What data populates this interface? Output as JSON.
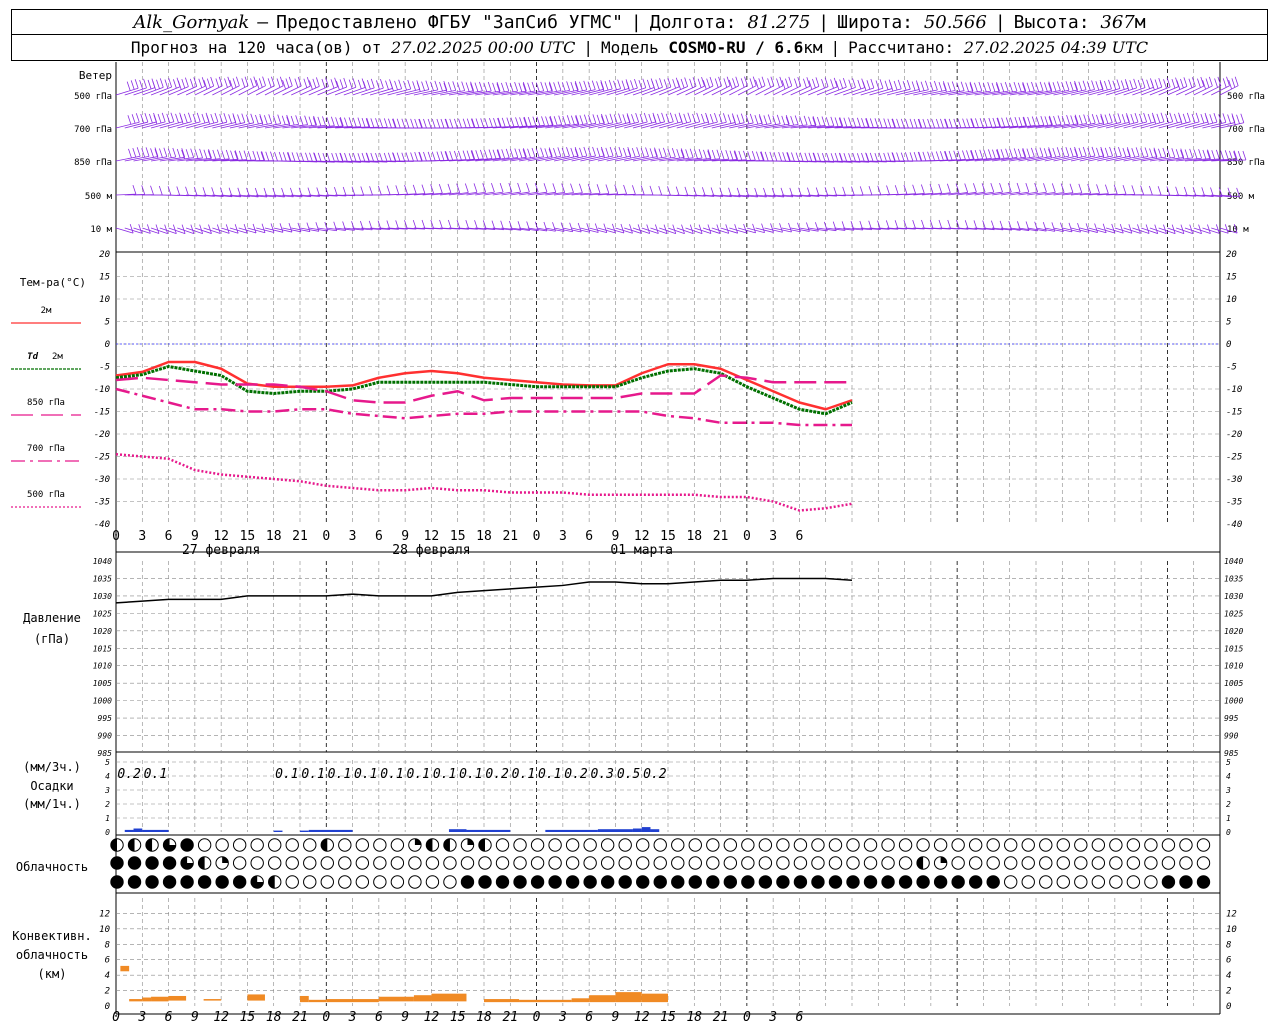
{
  "header": {
    "station": "Alk_Gornyak",
    "provider": "Предоставлено ФГБУ \"ЗапСиб УГМС\"",
    "lon_label": "Долгота:",
    "lon": "81.275",
    "lat_label": "Широта:",
    "lat": "50.566",
    "alt_label": "Высота:",
    "alt": "367",
    "alt_unit": "м",
    "forecast_label": "Прогноз на 120 часа(ов) от",
    "forecast_time": "27.02.2025 00:00 UTC",
    "model_label": "Модель",
    "model": "COSMO-RU / 6.6",
    "model_unit": "км",
    "calc_label": "Рассчитано:",
    "calc_time": "27.02.2025 04:39 UTC"
  },
  "colors": {
    "wind": "#8a2be2",
    "t2m": "#ff3030",
    "td2m": "#007000",
    "t850": "#e6198c",
    "t700": "#e6198c",
    "t500": "#e6198c",
    "pressure": "#000000",
    "precip": "#2040d0",
    "convective": "#f08a24",
    "zero_line": "#3030ff",
    "grid": "#888888"
  },
  "chart_data": [
    {
      "type": "wind_barbs",
      "title": "Ветер",
      "levels": [
        "500 гПа",
        "700 гПа",
        "850 гПа",
        "500 м",
        "10 м"
      ],
      "step_hours": 1,
      "hours": [
        0,
        126
      ]
    },
    {
      "type": "line",
      "title": "Тем-ра(°С)",
      "ylim": [
        -40,
        20
      ],
      "yticks": [
        20,
        15,
        10,
        5,
        0,
        -5,
        -10,
        -15,
        -20,
        -25,
        -30,
        -35,
        -40
      ],
      "x_hours_step": 3,
      "series": [
        {
          "name": "2м",
          "color_key": "t2m",
          "style": "solid",
          "values": [
            -7.0,
            -6.2,
            -4.0,
            -4.0,
            -5.5,
            -8.8,
            -9.5,
            -9.5,
            -9.5,
            -9.2,
            -7.5,
            -6.5,
            -6.0,
            -6.5,
            -7.5,
            -8.0,
            -8.5,
            -9.0,
            -9.2,
            -9.2,
            -6.5,
            -4.5,
            -4.5,
            -5.5,
            -8.0,
            -10.5,
            -13.0,
            -14.5,
            -12.5
          ]
        },
        {
          "name_label": "Td",
          "name": "2м",
          "color_key": "td2m",
          "style": "dotted",
          "values": [
            -7.5,
            -6.8,
            -5.0,
            -6.0,
            -7.0,
            -10.5,
            -11.0,
            -10.5,
            -10.5,
            -10.0,
            -8.5,
            -8.5,
            -8.5,
            -8.5,
            -8.5,
            -9.0,
            -9.5,
            -9.5,
            -9.5,
            -9.5,
            -7.5,
            -6.0,
            -5.5,
            -6.5,
            -9.5,
            -12.0,
            -14.5,
            -15.5,
            -13.0
          ]
        },
        {
          "name": "850 гПа",
          "color_key": "t850",
          "style": "dashed",
          "values": [
            -8.0,
            -7.5,
            -8.0,
            -8.5,
            -9.0,
            -9.0,
            -9.0,
            -9.5,
            -10.5,
            -12.5,
            -13.0,
            -13.0,
            -11.5,
            -10.5,
            -12.5,
            -12.0,
            -12.0,
            -12.0,
            -12.0,
            -12.0,
            -11.0,
            -11.0,
            -11.0,
            -7.0,
            -7.5,
            -8.5,
            -8.5,
            -8.5,
            -8.5
          ]
        },
        {
          "name": "700 гПа",
          "color_key": "t700",
          "style": "dashdot",
          "values": [
            -10.0,
            -11.5,
            -13.0,
            -14.5,
            -14.5,
            -15.0,
            -15.0,
            -14.5,
            -14.5,
            -15.5,
            -16.0,
            -16.5,
            -16.0,
            -15.5,
            -15.5,
            -15.0,
            -15.0,
            -15.0,
            -15.0,
            -15.0,
            -15.0,
            -16.0,
            -16.5,
            -17.5,
            -17.5,
            -17.5,
            -18.0,
            -18.0,
            -18.0
          ]
        },
        {
          "name": "500 гПа",
          "color_key": "t500",
          "style": "fine-dotted",
          "values": [
            -24.5,
            -25.0,
            -25.5,
            -28.0,
            -29.0,
            -29.5,
            -30.0,
            -30.5,
            -31.5,
            -32.0,
            -32.5,
            -32.5,
            -32.0,
            -32.5,
            -32.5,
            -33.0,
            -33.0,
            -33.0,
            -33.5,
            -33.5,
            -33.5,
            -33.5,
            -33.5,
            -34.0,
            -34.0,
            -35.0,
            -37.0,
            -36.5,
            -35.5
          ]
        }
      ]
    },
    {
      "type": "line",
      "title": "Давление",
      "ylabel": "(гПа)",
      "ylim": [
        985,
        1040
      ],
      "yticks": [
        1040,
        1035,
        1030,
        1025,
        1020,
        1015,
        1010,
        1005,
        1000,
        995,
        990,
        985
      ],
      "x_hours_step": 3,
      "series": [
        {
          "color_key": "pressure",
          "values": [
            1028.0,
            1028.5,
            1029.0,
            1029.0,
            1029.0,
            1030.0,
            1030.0,
            1030.0,
            1030.0,
            1030.5,
            1030.0,
            1030.0,
            1030.0,
            1031.0,
            1031.5,
            1032.0,
            1032.5,
            1033.0,
            1034.0,
            1034.0,
            1033.5,
            1033.5,
            1034.0,
            1034.5,
            1034.5,
            1035.0,
            1035.0,
            1035.0,
            1034.5
          ]
        }
      ]
    },
    {
      "type": "bar",
      "title": "Осадки",
      "units_3h": "(мм/3ч.)",
      "units_1h": "(мм/1ч.)",
      "ylim": [
        0,
        5
      ],
      "yticks": [
        5,
        4,
        3,
        2,
        1,
        0
      ],
      "amounts_3h": [
        {
          "h": 1.5,
          "label": "0.2"
        },
        {
          "h": 4.5,
          "label": "0.1"
        },
        {
          "h": 19.5,
          "label": "0.1"
        },
        {
          "h": 22.5,
          "label": "0.1"
        },
        {
          "h": 25.5,
          "label": "0.1"
        },
        {
          "h": 28.5,
          "label": "0.1"
        },
        {
          "h": 31.5,
          "label": "0.1"
        },
        {
          "h": 34.5,
          "label": "0.1"
        },
        {
          "h": 37.5,
          "label": "0.1"
        },
        {
          "h": 40.5,
          "label": "0.1"
        },
        {
          "h": 43.5,
          "label": "0.2"
        },
        {
          "h": 46.5,
          "label": "0.1"
        },
        {
          "h": 49.5,
          "label": "0.1"
        },
        {
          "h": 52.5,
          "label": "0.2"
        },
        {
          "h": 55.5,
          "label": "0.3"
        },
        {
          "h": 58.5,
          "label": "0.5"
        },
        {
          "h": 61.5,
          "label": "0.2"
        }
      ],
      "hourly": [
        {
          "from": 1,
          "to": 2,
          "v": 0.15
        },
        {
          "from": 2,
          "to": 3,
          "v": 0.25
        },
        {
          "from": 3,
          "to": 6,
          "v": 0.15
        },
        {
          "from": 18,
          "to": 19,
          "v": 0.1
        },
        {
          "from": 21,
          "to": 22,
          "v": 0.1
        },
        {
          "from": 22,
          "to": 27,
          "v": 0.15
        },
        {
          "from": 38,
          "to": 40,
          "v": 0.2
        },
        {
          "from": 40,
          "to": 45,
          "v": 0.15
        },
        {
          "from": 49,
          "to": 55,
          "v": 0.15
        },
        {
          "from": 55,
          "to": 59,
          "v": 0.2
        },
        {
          "from": 59,
          "to": 60,
          "v": 0.25
        },
        {
          "from": 60,
          "to": 61,
          "v": 0.35
        },
        {
          "from": 61,
          "to": 62,
          "v": 0.2
        }
      ]
    },
    {
      "type": "cloud_symbols",
      "title": "Облачность",
      "step_hours": 2,
      "count": 63,
      "rows": {
        "upper": {
          "partial": {
            "0": "0.5",
            "1": "0.5",
            "2": "0.5",
            "3": "0.75",
            "4": "1",
            "12": "0.5",
            "17": "0.25",
            "18": "0.5",
            "19": "0.5",
            "20": "0.25",
            "21": "0.5"
          }
        },
        "middle": {
          "partial": {
            "0": "1",
            "1": "1",
            "2": "1",
            "3": "1",
            "4": "0.75",
            "5": "0.5",
            "6": "0.25",
            "46": "0.5",
            "47": "0.25"
          }
        },
        "lower": {
          "full_from": 0,
          "full_to": 50,
          "partial": {
            "8": "0.75",
            "9": "0.5",
            "10": "0",
            "11": "0",
            "12": "0",
            "13": "0",
            "14": "0",
            "15": "0",
            "16": "0",
            "17": "0",
            "18": "0",
            "19": "0",
            "61": "1",
            "62": "1",
            "60": "1"
          }
        }
      }
    },
    {
      "type": "bar",
      "title": "Конвективн. облачность",
      "ylabel": "(км)",
      "ylim": [
        0,
        14
      ],
      "yticks": [
        12,
        10,
        8,
        6,
        4,
        2,
        0
      ],
      "segments": [
        {
          "from": 0.5,
          "to": 1.5,
          "bottom": 4.5,
          "top": 5.2
        },
        {
          "from": 1.5,
          "to": 3,
          "bottom": 0.6,
          "top": 0.9
        },
        {
          "from": 3,
          "to": 4,
          "bottom": 0.6,
          "top": 1.1
        },
        {
          "from": 4,
          "to": 6,
          "bottom": 0.6,
          "top": 1.2
        },
        {
          "from": 6,
          "to": 8,
          "bottom": 0.7,
          "top": 1.3
        },
        {
          "from": 10,
          "to": 12,
          "bottom": 0.7,
          "top": 0.9
        },
        {
          "from": 15,
          "to": 17,
          "bottom": 0.7,
          "top": 1.5
        },
        {
          "from": 21,
          "to": 22,
          "bottom": 0.5,
          "top": 1.3
        },
        {
          "from": 22,
          "to": 24,
          "bottom": 0.5,
          "top": 0.8
        },
        {
          "from": 24,
          "to": 30,
          "bottom": 0.5,
          "top": 0.9
        },
        {
          "from": 30,
          "to": 34,
          "bottom": 0.6,
          "top": 1.2
        },
        {
          "from": 34,
          "to": 36,
          "bottom": 0.6,
          "top": 1.4
        },
        {
          "from": 36,
          "to": 40,
          "bottom": 0.6,
          "top": 1.6
        },
        {
          "from": 42,
          "to": 46,
          "bottom": 0.5,
          "top": 0.9
        },
        {
          "from": 46,
          "to": 52,
          "bottom": 0.5,
          "top": 0.8
        },
        {
          "from": 52,
          "to": 54,
          "bottom": 0.5,
          "top": 1.0
        },
        {
          "from": 54,
          "to": 57,
          "bottom": 0.5,
          "top": 1.4
        },
        {
          "from": 57,
          "to": 60,
          "bottom": 0.5,
          "top": 1.8
        },
        {
          "from": 60,
          "to": 63,
          "bottom": 0.5,
          "top": 1.6
        }
      ]
    }
  ],
  "axis": {
    "hour_labels": [
      "0",
      "3",
      "6",
      "9",
      "12",
      "15",
      "18",
      "21",
      "0",
      "3",
      "6",
      "9",
      "12",
      "15",
      "18",
      "21",
      "0",
      "3",
      "6",
      "9",
      "12",
      "15",
      "18",
      "21",
      "0",
      "3",
      "6"
    ],
    "day_labels": [
      "27 февраля",
      "28 февраля",
      "01 марта"
    ]
  }
}
